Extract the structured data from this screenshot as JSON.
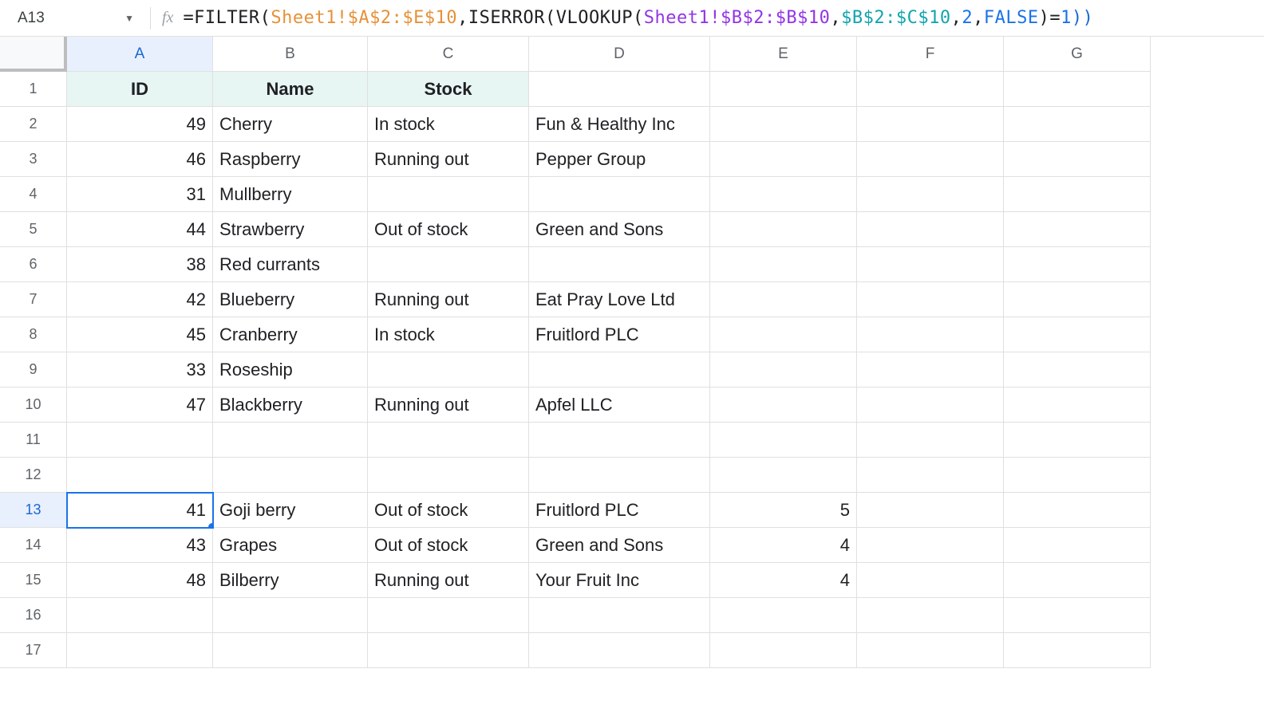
{
  "nameBox": "A13",
  "formula": {
    "parts": [
      {
        "t": "=FILTER(",
        "c": "f-black"
      },
      {
        "t": "Sheet1!$A$2:$E$10",
        "c": "f-orange"
      },
      {
        "t": ",ISERROR(VLOOKUP(",
        "c": "f-black"
      },
      {
        "t": "Sheet1!$B$2:$B$10",
        "c": "f-purple"
      },
      {
        "t": ",",
        "c": "f-black"
      },
      {
        "t": "$B$2:$C$10",
        "c": "f-teal"
      },
      {
        "t": ",",
        "c": "f-black"
      },
      {
        "t": "2",
        "c": "f-blue"
      },
      {
        "t": ",",
        "c": "f-black"
      },
      {
        "t": "FALSE",
        "c": "f-blue"
      },
      {
        "t": ")=",
        "c": "f-black"
      },
      {
        "t": "1",
        "c": "f-blue"
      },
      {
        "t": "))",
        "c": "f-paren"
      }
    ]
  },
  "columns": [
    "A",
    "B",
    "C",
    "D",
    "E",
    "F",
    "G"
  ],
  "activeColIndex": 0,
  "rowCount": 17,
  "activeRow": 13,
  "headers": {
    "A": "ID",
    "B": "Name",
    "C": "Stock"
  },
  "rows": [
    {
      "n": 2,
      "A": "49",
      "B": "Cherry",
      "C": "In stock",
      "D": "Fun & Healthy Inc"
    },
    {
      "n": 3,
      "A": "46",
      "B": "Raspberry",
      "C": "Running out",
      "D": "Pepper Group"
    },
    {
      "n": 4,
      "A": "31",
      "B": "Mullberry"
    },
    {
      "n": 5,
      "A": "44",
      "B": "Strawberry",
      "C": "Out of stock",
      "D": "Green and Sons"
    },
    {
      "n": 6,
      "A": "38",
      "B": "Red currants"
    },
    {
      "n": 7,
      "A": "42",
      "B": "Blueberry",
      "C": "Running out",
      "D": "Eat Pray Love Ltd"
    },
    {
      "n": 8,
      "A": "45",
      "B": "Cranberry",
      "C": "In stock",
      "D": "Fruitlord PLC"
    },
    {
      "n": 9,
      "A": "33",
      "B": "Roseship"
    },
    {
      "n": 10,
      "A": "47",
      "B": "Blackberry",
      "C": "Running out",
      "D": "Apfel LLC"
    },
    {
      "n": 11
    },
    {
      "n": 12
    },
    {
      "n": 13,
      "A": "41",
      "B": "Goji berry",
      "C": "Out of stock",
      "D": "Fruitlord PLC",
      "E": "5"
    },
    {
      "n": 14,
      "A": "43",
      "B": "Grapes",
      "C": "Out of stock",
      "D": "Green and Sons",
      "E": "4"
    },
    {
      "n": 15,
      "A": "48",
      "B": "Bilberry",
      "C": "Running out",
      "D": "Your Fruit Inc",
      "E": "4"
    },
    {
      "n": 16
    },
    {
      "n": 17
    }
  ]
}
